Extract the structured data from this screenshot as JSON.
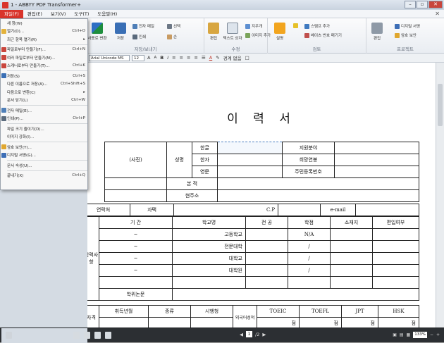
{
  "window": {
    "title": "1 - ABBYY PDF Transformer+"
  },
  "menu": {
    "items": [
      "파일(F)",
      "편집(E)",
      "보기(V)",
      "도구(T)",
      "도움말(H)"
    ]
  },
  "ribbon": {
    "g1": {
      "label": "저장/보내기",
      "convert": "사용로 변환",
      "save": "저장",
      "mail": "전자 메일",
      "print": "인쇄",
      "select": "선택",
      "hand": "손"
    },
    "g2": {
      "label": "수정",
      "edit": "편집",
      "textbox": "텍스트 상자",
      "erase": "지우개",
      "image_add": "이미지 추가"
    },
    "g3": {
      "label": "검토",
      "comment": "설명",
      "stamp_add": "스탬프 추가",
      "bates": "베이츠 번호 매기기"
    },
    "g4": {
      "label": "프로젝트",
      "edit": "편집",
      "signature": "디지털 서명",
      "security": "암호 보안"
    }
  },
  "format": {
    "font": "Arial Unicode MS",
    "size": "12",
    "bold": "B",
    "italic": "I",
    "grow": "A",
    "shrink": "A",
    "color_a": "A",
    "border_label": "경계 없음"
  },
  "dropdown": [
    {
      "label": "새 창(W)",
      "shortcut": ""
    },
    {
      "label": "열기(O)...",
      "shortcut": "Ctrl+O"
    },
    {
      "label": "최근 항목 열기(R)",
      "shortcut": "▸"
    },
    {
      "sep": true
    },
    {
      "label": "파일로부터 만들기(F)...",
      "shortcut": "Ctrl+N"
    },
    {
      "label": "여러 파일로부터 만들기(M)...",
      "shortcut": ""
    },
    {
      "label": "스캐너로부터 만들기(T)...",
      "shortcut": "Ctrl+K"
    },
    {
      "sep": true
    },
    {
      "label": "저장(S)",
      "shortcut": "Ctrl+S"
    },
    {
      "label": "다른 이름으로 저장(A)...",
      "shortcut": "Ctrl+Shift+S"
    },
    {
      "label": "다음으로 변환(C)",
      "shortcut": "▸"
    },
    {
      "label": "문서 닫기(L)",
      "shortcut": "Ctrl+W"
    },
    {
      "sep": true
    },
    {
      "label": "전자 메일(E)...",
      "shortcut": ""
    },
    {
      "label": "인쇄(P)...",
      "shortcut": "Ctrl+P"
    },
    {
      "sep": true
    },
    {
      "label": "파일 크기 줄이기(D)...",
      "shortcut": ""
    },
    {
      "label": "이미지 강화(I)...",
      "shortcut": ""
    },
    {
      "sep": true
    },
    {
      "label": "암호 보안(Y)...",
      "shortcut": ""
    },
    {
      "label": "디지털 서명(G)...",
      "shortcut": ""
    },
    {
      "sep": true
    },
    {
      "label": "문서 속성(U)...",
      "shortcut": ""
    },
    {
      "sep": true
    },
    {
      "label": "끝내기(X)",
      "shortcut": "Ctrl+Q"
    }
  ],
  "document": {
    "title": "이 력 서",
    "photo": "(사진)",
    "name": "성명",
    "korean": "한글",
    "hanja": "한자",
    "english": "영문",
    "desired_field": "지원분야",
    "desired_salary": "희망연봉",
    "resident_number": "주민등록번호",
    "domicile": "본 적",
    "address": "현주소",
    "contact": "연락처",
    "home": "자택",
    "cp": "C.P",
    "email": "e-mail",
    "period": "기 간",
    "school": "학교명",
    "major": "전 공",
    "gpa": "학점",
    "location": "소재지",
    "transfer": "편입여부",
    "education_label": "학력사항",
    "range_mark": "~",
    "high_school": "고등학교",
    "college": "전문대학",
    "university": "대학교",
    "graduate": "대학원",
    "na": "N/A",
    "slash": "/",
    "thesis": "학위논문",
    "self_label": "자격",
    "acquired": "취득년월",
    "type": "종류",
    "issuer": "시행청",
    "foreign": "외국어성적",
    "toeic": "TOEIC",
    "toefl": "TOEFL",
    "jpt": "JPT",
    "hsk": "HSK",
    "score": "점"
  },
  "status": {
    "page": "1",
    "total": "/2",
    "zoom": "133%"
  }
}
